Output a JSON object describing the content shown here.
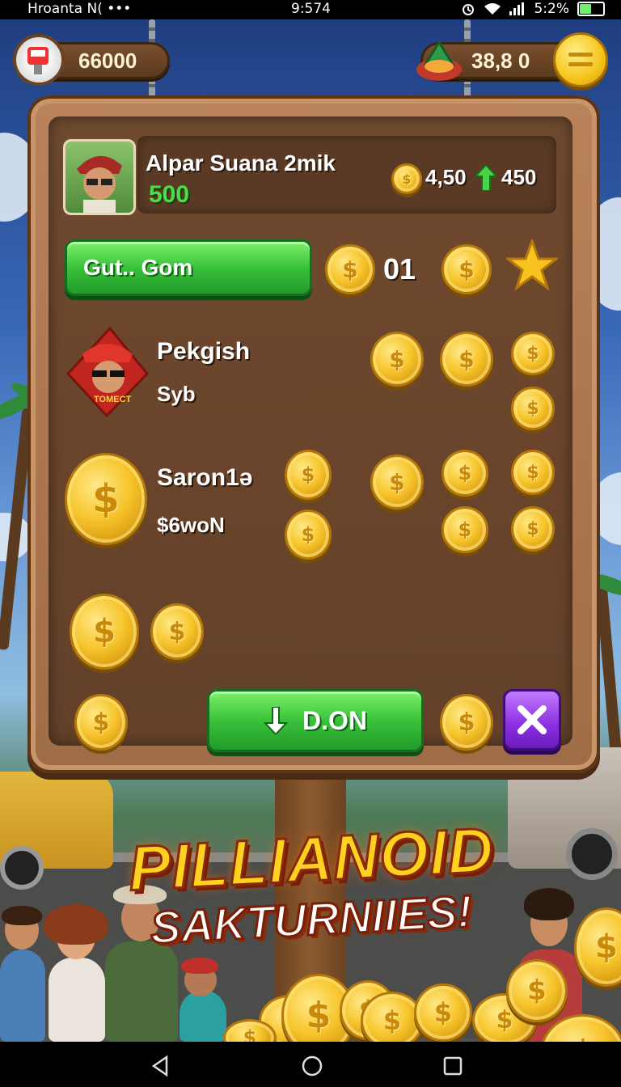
{
  "status_bar": {
    "carrier": "Hroanta  N(  •••",
    "time": "9:574",
    "battery_text": "5:2%",
    "battery_level": 0.52
  },
  "top_bar": {
    "left_currency": "66000",
    "right_currency": "38,8  0"
  },
  "profile": {
    "name": "Alpar Suana 2mik",
    "score": "500",
    "coins": "4,50",
    "gems": "450"
  },
  "action_row": {
    "button_label": "Gut.. Gom",
    "counter": "01"
  },
  "rows": [
    {
      "title": "Pekgish",
      "subtitle": "Syb"
    },
    {
      "title": "Saron1ə",
      "subtitle": "$6woN"
    }
  ],
  "tag_text": "TOMECT",
  "coin_symbol": "$",
  "down_button": {
    "label": "D.ON"
  },
  "promo": {
    "title": "PILLIANOID",
    "subtitle": "SAKTURNIIES!"
  },
  "colors": {
    "board_wood": "#9e6c46",
    "gold": "#f7c52c",
    "green_button": "#39c23a",
    "purple_button": "#8a2ee0",
    "score_green": "#49e046"
  }
}
